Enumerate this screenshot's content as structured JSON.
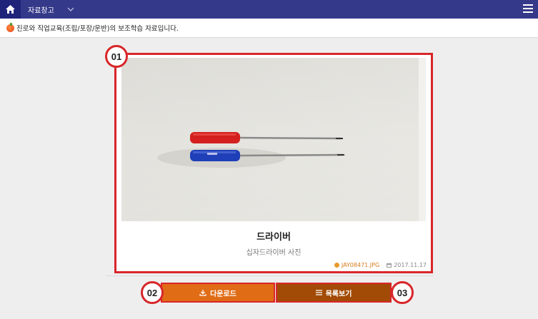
{
  "topbar": {
    "home_icon": "home-icon",
    "breadcrumb_label": "자료창고",
    "chevron_icon": "chevron-down-icon",
    "menu_icon": "hamburger-menu-icon",
    "background": "#35398a"
  },
  "notice": {
    "icon": "tomato-icon",
    "text": "진로와 직업교육(조립/포장/운반)의 보조학습 자료입니다."
  },
  "resource": {
    "title": "드라이버",
    "description": "십자드라이버 사진",
    "file_name": "JAY08471.JPG",
    "date": "2017.11.17"
  },
  "actions": {
    "download_label": "다운로드",
    "download_icon": "download-icon",
    "list_label": "목록보기",
    "list_icon": "list-icon"
  },
  "callouts": {
    "c1": "01",
    "c2": "02",
    "c3": "03"
  },
  "colors": {
    "highlight": "#d8262a",
    "download_button": "#e06c15",
    "list_button": "#a24b06",
    "file_link": "#d77a1a"
  }
}
